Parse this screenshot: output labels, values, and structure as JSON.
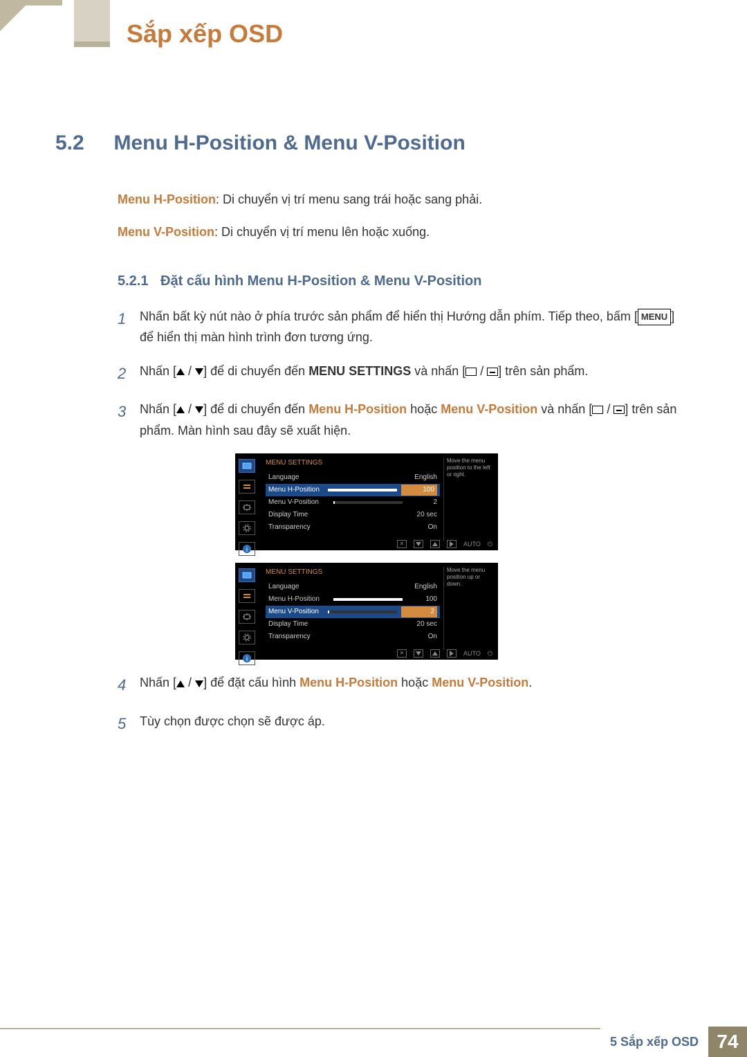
{
  "chapter_title": "Sắp xếp OSD",
  "section": {
    "number": "5.2",
    "title": "Menu H-Position & Menu V-Position"
  },
  "desc": {
    "h_label": "Menu H-Position",
    "h_text": ": Di chuyển vị trí menu sang trái hoặc sang phải.",
    "v_label": "Menu V-Position",
    "v_text": ": Di chuyển vị trí menu lên hoặc xuống."
  },
  "subsection": {
    "number": "5.2.1",
    "title": "Đặt cấu hình Menu H-Position & Menu V-Position"
  },
  "steps": {
    "s1a": "Nhấn bất kỳ nút nào ở phía trước sản phẩm để hiển thị Hướng dẫn phím. Tiếp theo, bấm [",
    "s1_menu": "MENU",
    "s1b": "] để hiển thị màn hình trình đơn tương ứng.",
    "s2a": "Nhấn [",
    "s2b": "] để di chuyển đến ",
    "s2_bold": "MENU SETTINGS",
    "s2c": " và nhấn [",
    "s2d": "] trên sản phẩm.",
    "s3a": "Nhấn [",
    "s3b": "] để di chuyển đến ",
    "s3_h": "Menu H-Position",
    "s3_or": " hoặc ",
    "s3_v": "Menu V-Position",
    "s3c": " và nhấn [",
    "s3d": "] trên sản phẩm. Màn hình sau đây sẽ xuất hiện.",
    "s4a": "Nhấn [",
    "s4b": "] để đặt cấu hình ",
    "s4_h": "Menu H-Position",
    "s4_or": " hoặc ",
    "s4_v": "Menu V-Position",
    "s4c": ".",
    "s5": "Tùy chọn được chọn sẽ được áp."
  },
  "osd": {
    "title": "MENU SETTINGS",
    "rows": [
      {
        "label": "Language",
        "value": "English"
      },
      {
        "label": "Menu H-Position",
        "value": "100",
        "bar": 100
      },
      {
        "label": "Menu V-Position",
        "value": "2",
        "bar": 2
      },
      {
        "label": "Display Time",
        "value": "20 sec"
      },
      {
        "label": "Transparency",
        "value": "On"
      }
    ],
    "desc1": "Move the menu position to the left or right.",
    "desc2": "Move the menu position up or down.",
    "auto": "AUTO"
  },
  "footer": {
    "label": "5 Sắp xếp OSD",
    "page": "74"
  }
}
